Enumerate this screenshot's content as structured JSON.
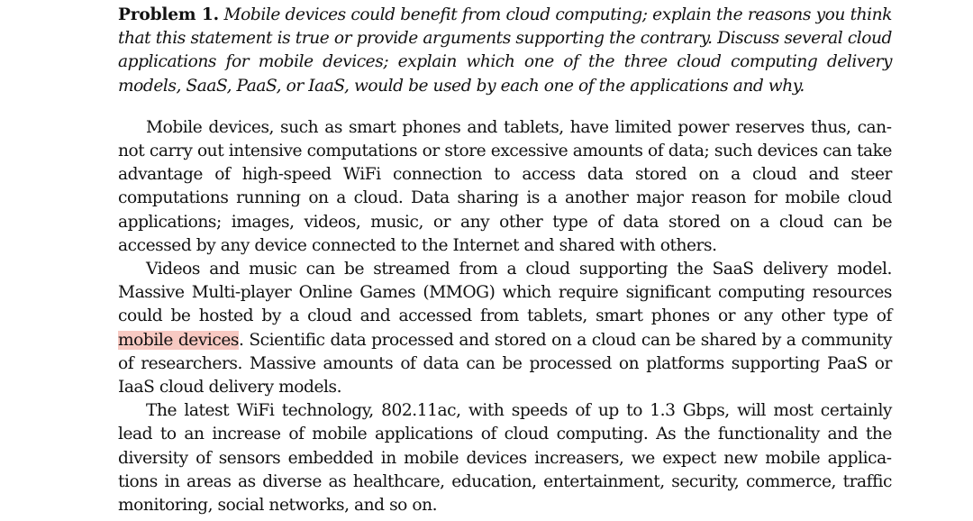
{
  "problem": {
    "label": "Problem 1.",
    "statement": "Mobile devices could benefit from cloud computing; explain the reasons you think that this statement is true or provide arguments supporting the contrary. Discuss several cloud applications for mobile devices; explain which one of the three cloud computing delivery models, SaaS, PaaS, or IaaS, would be used by each one of the applications and why."
  },
  "paragraphs": [
    {
      "text": "Mobile devices, such as smart phones and tablets, have limited power reserves thus, can­not carry out intensive computations or store excessive amounts of data; such devices can take advantage of high-speed WiFi connection to access data stored on a cloud and steer computations running on a cloud. Data sharing is a another major reason for mobile cloud applications; images, videos, music, or any other type of data stored on a cloud can be accessed by any device connected to the Internet and shared with others."
    },
    {
      "before": "Videos and music can be streamed from a cloud supporting the SaaS delivery model. Massive Multi-player Online Games (MMOG) which require significant computing resources could be hosted by a cloud and accessed from tablets, smart phones or any other type of ",
      "highlight": "mobile devices",
      "after": ". Scientific data processed and stored on a cloud can be shared by a community of researchers. Massive amounts of data can be processed on platforms supporting PaaS or IaaS cloud delivery models."
    },
    {
      "text": "The latest WiFi technology, 802.11ac, with speeds of up to 1.3 Gbps, will most certainly lead to an increase of mobile applications of cloud computing. As the functionality and the diversity of sensors embedded in mobile devices increasers, we expect new mobile applica­tions in areas as diverse as healthcare, education, entertainment, security, commerce, traffic monitoring, social networks, and so on."
    }
  ],
  "colors": {
    "highlight": "#f7c9c2",
    "text": "#111111",
    "background": "#ffffff"
  }
}
